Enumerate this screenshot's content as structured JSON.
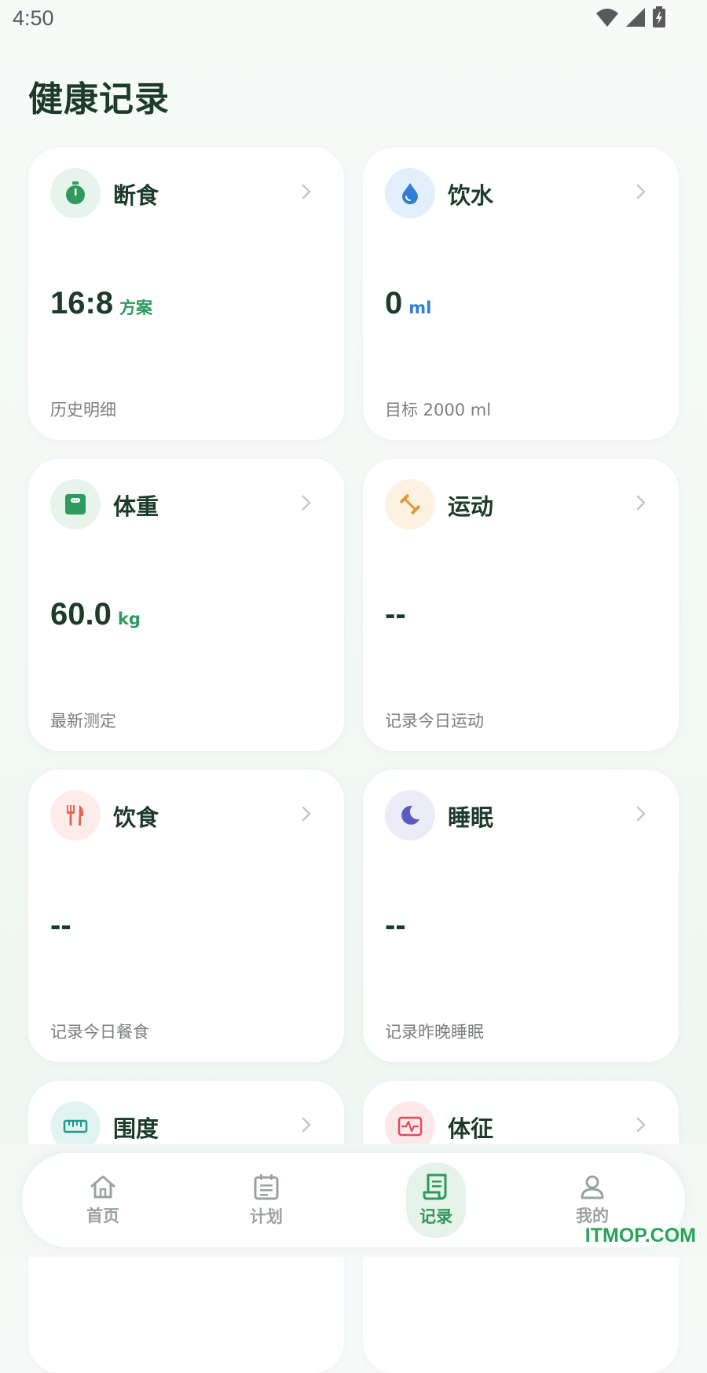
{
  "status": {
    "time": "4:50"
  },
  "page": {
    "title": "健康记录"
  },
  "colors": {
    "primary": "#2e9a5e",
    "water": "#2f7fd6"
  },
  "cards": [
    {
      "title": "断食",
      "value": "16:8",
      "unit": "方案",
      "sub": "历史明细",
      "icon": "stopwatch-icon",
      "icon_bg": "#e6f4ec",
      "icon_color": "#2e9a5e",
      "unit_color": "#2e9a5e"
    },
    {
      "title": "饮水",
      "value": "0",
      "unit": "ml",
      "sub": "目标 2000 ml",
      "icon": "water-drop-icon",
      "icon_bg": "#e4effc",
      "icon_color": "#2f7fd6",
      "unit_color": "#2f7fd6"
    },
    {
      "title": "体重",
      "value": "60.0",
      "unit": "kg",
      "sub": "最新测定",
      "icon": "scale-icon",
      "icon_bg": "#e6f4ec",
      "icon_color": "#2e9a5e",
      "unit_color": "#2e9a5e"
    },
    {
      "title": "运动",
      "value": "--",
      "unit": "",
      "sub": "记录今日运动",
      "icon": "dumbbell-icon",
      "icon_bg": "#fdf1e2",
      "icon_color": "#e19a32",
      "unit_color": "#e19a32"
    },
    {
      "title": "饮食",
      "value": "--",
      "unit": "",
      "sub": "记录今日餐食",
      "icon": "fork-knife-icon",
      "icon_bg": "#fdecea",
      "icon_color": "#e0664f",
      "unit_color": "#e0664f"
    },
    {
      "title": "睡眠",
      "value": "--",
      "unit": "",
      "sub": "记录昨晚睡眠",
      "icon": "moon-icon",
      "icon_bg": "#ecebf8",
      "icon_color": "#5a5cc4",
      "unit_color": "#5a5cc4"
    },
    {
      "title": "围度",
      "value": "",
      "unit": "",
      "sub": "",
      "icon": "ruler-icon",
      "icon_bg": "#e2f4f1",
      "icon_color": "#1f9a8c",
      "unit_color": "#1f9a8c"
    },
    {
      "title": "体征",
      "value": "",
      "unit": "",
      "sub": "",
      "icon": "vitals-icon",
      "icon_bg": "#fde8ea",
      "icon_color": "#e04b5c",
      "unit_color": "#e04b5c"
    }
  ],
  "nav": {
    "items": [
      {
        "label": "首页",
        "icon": "home-icon"
      },
      {
        "label": "计划",
        "icon": "calendar-icon"
      },
      {
        "label": "记录",
        "icon": "record-icon"
      },
      {
        "label": "我的",
        "icon": "profile-icon"
      }
    ],
    "active_index": 2
  },
  "watermark": "ITMOP.COM"
}
